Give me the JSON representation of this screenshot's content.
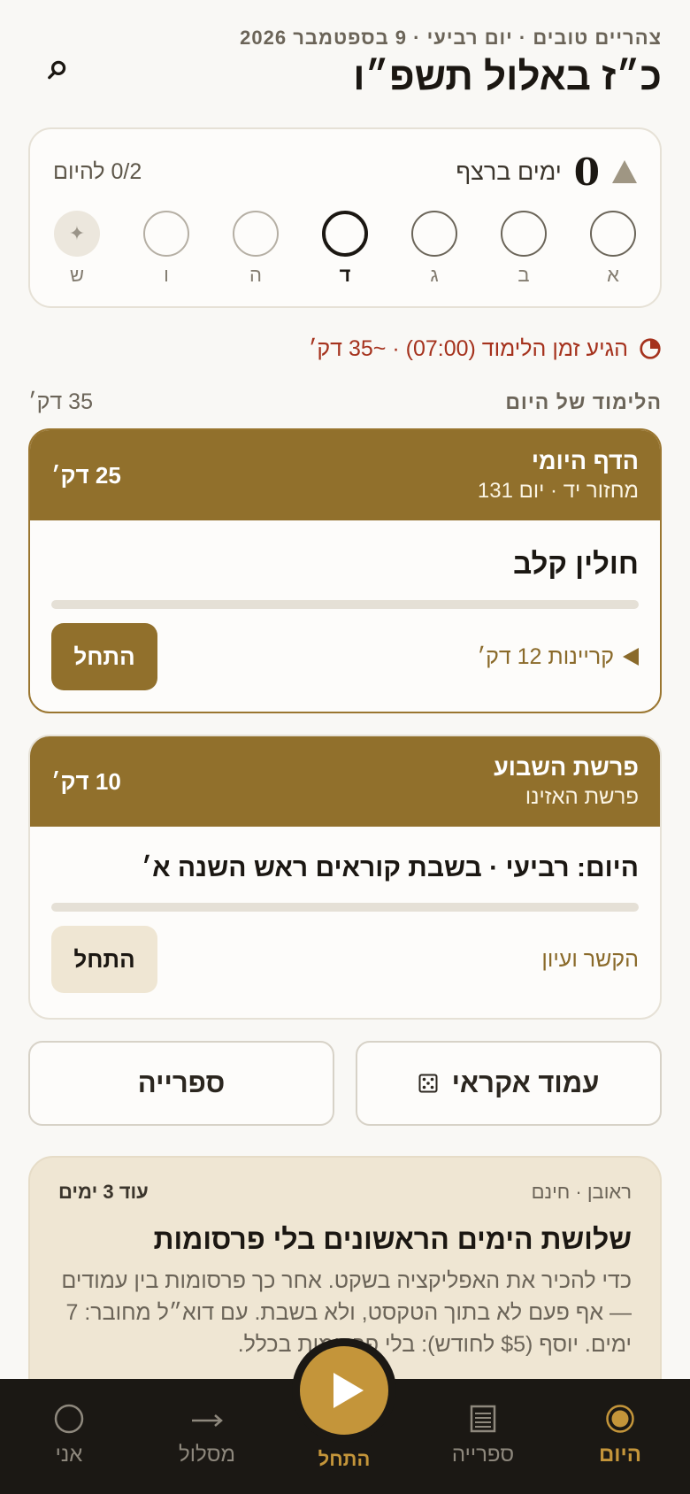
{
  "header": {
    "greeting": "צהריים טובים · יום רביעי · 9 בספטמבר 2026",
    "hebrew_date": "כ״ז באלול תשפ״ו"
  },
  "streak": {
    "count": "0",
    "label": "ימים ברצף",
    "today_progress": "0/2 להיום",
    "days": [
      {
        "label": "א",
        "state": "done-outline"
      },
      {
        "label": "ב",
        "state": "done-outline"
      },
      {
        "label": "ג",
        "state": "done-outline"
      },
      {
        "label": "ד",
        "state": "today"
      },
      {
        "label": "ה",
        "state": "future"
      },
      {
        "label": "ו",
        "state": "future"
      },
      {
        "label": "ש",
        "state": "shabbat",
        "glyph": "✦"
      }
    ]
  },
  "alert": {
    "text": "הגיע זמן הלימוד (07:00) · ~35 דק׳",
    "color": "#a5321d"
  },
  "section": {
    "title": "הלימוד של היום",
    "total": "35 דק׳"
  },
  "lessons": [
    {
      "title": "הדף היומי",
      "subtitle": "מחזור יד · יום 131",
      "minutes": "25 דק׳",
      "text": "חולין קלב",
      "progress": 0,
      "link": "קריינות 12 דק׳",
      "button": "התחל"
    },
    {
      "title": "פרשת השבוע",
      "subtitle": "פרשת האזינו",
      "minutes": "10 דק׳",
      "text": "היום: רביעי · בשבת קוראים ראש השנה א׳",
      "progress": 0,
      "link": "הקשר ועיון",
      "button": "התחל"
    }
  ],
  "quick": {
    "random_page": "עמוד אקראי",
    "library": "ספרייה"
  },
  "promo": {
    "by": "ראובן · חינם",
    "remaining": "עוד 3 ימים",
    "title": "שלושת הימים הראשונים בלי פרסומות",
    "body": "כדי להכיר את האפליקציה בשקט. אחר כך פרסומות בין עמודים — אף פעם לא בתוך הטקסט, ולא בשבת. עם דוא״ל מחובר: 7 ימים. יוסף ($5 לחודש): בלי פרסומות בכלל."
  },
  "tabbar": {
    "today": "היום",
    "library": "ספרייה",
    "start": "התחל",
    "path": "מסלול",
    "me": "אני"
  },
  "colors": {
    "accent": "#91702c",
    "accent_bright": "#c4953a",
    "alert": "#a5321d",
    "tabbar_bg": "#1b1814"
  }
}
